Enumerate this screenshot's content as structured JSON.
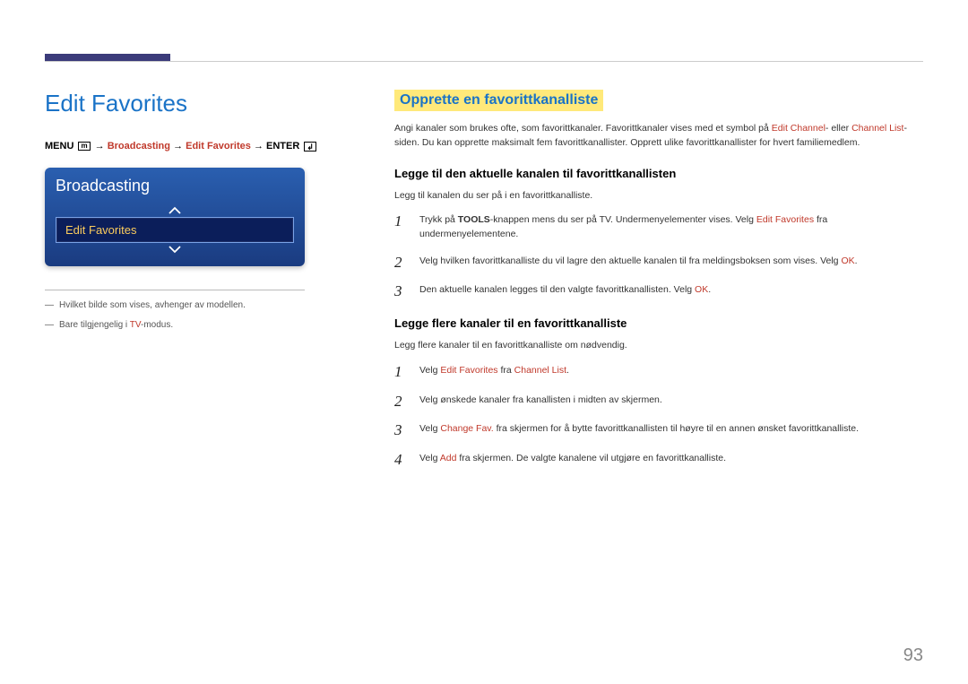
{
  "page_number": "93",
  "left": {
    "title": "Edit Favorites",
    "breadcrumb": {
      "menu": "MENU",
      "sep": " → ",
      "p1": "Broadcasting",
      "p2": "Edit Favorites",
      "enter": "ENTER"
    },
    "panel": {
      "header": "Broadcasting",
      "item": "Edit Favorites"
    },
    "notes": {
      "n1_pre": "Hvilket bilde som vises, avhenger av modellen.",
      "n2_pre": "Bare tilgjengelig i ",
      "n2_red": "TV",
      "n2_post": "-modus."
    }
  },
  "right": {
    "h2": "Opprette en favorittkanalliste",
    "intro_pre": "Angi kanaler som brukes ofte, som favorittkanaler. Favorittkanaler vises med et symbol på ",
    "intro_ec": "Edit Channel",
    "intro_mid": "- eller ",
    "intro_cl": "Channel List",
    "intro_post": "-siden. Du kan opprette maksimalt fem favorittkanallister. Opprett ulike favorittkanallister for hvert familiemedlem.",
    "sub1": "Legge til den aktuelle kanalen til favorittkanallisten",
    "sub1_intro": "Legg til kanalen du ser på i en favorittkanalliste.",
    "s1": {
      "n1": "1",
      "t1a": "Trykk på ",
      "t1_tools": "TOOLS",
      "t1b": "-knappen mens du ser på TV. Undermenyelementer vises. Velg ",
      "t1_ef": "Edit Favorites",
      "t1c": " fra undermenyelementene.",
      "n2": "2",
      "t2a": "Velg hvilken favorittkanalliste du vil lagre den aktuelle kanalen til fra meldingsboksen som vises. Velg ",
      "t2_ok": "OK",
      "t2b": ".",
      "n3": "3",
      "t3a": "Den aktuelle kanalen legges til den valgte favorittkanallisten. Velg ",
      "t3_ok": "OK",
      "t3b": "."
    },
    "sub2": "Legge flere kanaler til en favorittkanalliste",
    "sub2_intro": "Legg flere kanaler til en favorittkanalliste om nødvendig.",
    "s2": {
      "n1": "1",
      "t1a": "Velg ",
      "t1_ef": "Edit Favorites",
      "t1b": " fra ",
      "t1_cl": "Channel List",
      "t1c": ".",
      "n2": "2",
      "t2": "Velg ønskede kanaler fra kanallisten i midten av skjermen.",
      "n3": "3",
      "t3a": "Velg ",
      "t3_cf": "Change Fav.",
      "t3b": " fra skjermen for å bytte favorittkanallisten til høyre til en annen ønsket favorittkanalliste.",
      "n4": "4",
      "t4a": "Velg ",
      "t4_add": "Add",
      "t4b": " fra skjermen. De valgte kanalene vil utgjøre en favorittkanalliste."
    }
  }
}
